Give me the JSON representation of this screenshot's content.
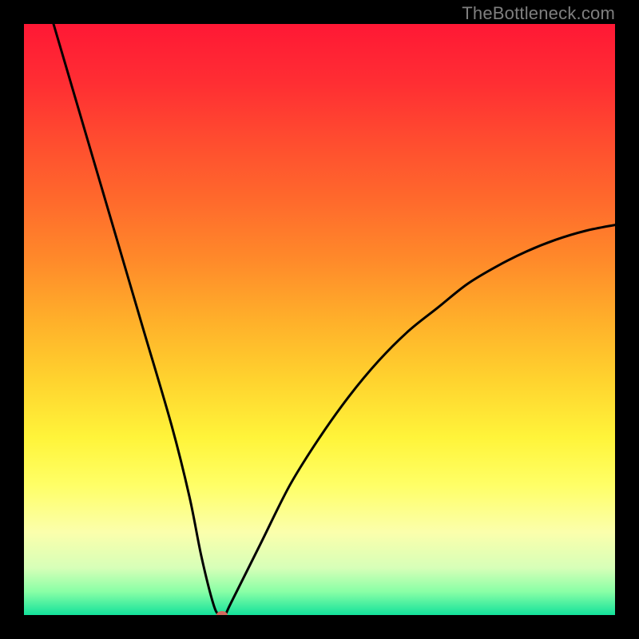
{
  "attribution": "TheBottleneck.com",
  "chart_data": {
    "type": "line",
    "title": "",
    "xlabel": "",
    "ylabel": "",
    "xlim": [
      0,
      100
    ],
    "ylim": [
      0,
      100
    ],
    "grid": false,
    "background_gradient_stops": [
      {
        "pos": 0.0,
        "color": "#ff1835"
      },
      {
        "pos": 0.1,
        "color": "#ff2e33"
      },
      {
        "pos": 0.2,
        "color": "#ff4d2f"
      },
      {
        "pos": 0.3,
        "color": "#ff6a2c"
      },
      {
        "pos": 0.4,
        "color": "#ff8a2a"
      },
      {
        "pos": 0.5,
        "color": "#ffaf2a"
      },
      {
        "pos": 0.6,
        "color": "#ffd22e"
      },
      {
        "pos": 0.7,
        "color": "#fff43a"
      },
      {
        "pos": 0.78,
        "color": "#ffff66"
      },
      {
        "pos": 0.86,
        "color": "#fbffac"
      },
      {
        "pos": 0.92,
        "color": "#d7ffb8"
      },
      {
        "pos": 0.96,
        "color": "#8affa6"
      },
      {
        "pos": 1.0,
        "color": "#13e29b"
      }
    ],
    "series": [
      {
        "name": "bottleneck-curve",
        "x": [
          5,
          10,
          15,
          20,
          25,
          28,
          30,
          32,
          33,
          34,
          35,
          40,
          45,
          50,
          55,
          60,
          65,
          70,
          75,
          80,
          85,
          90,
          95,
          100
        ],
        "y": [
          100,
          83,
          66,
          49,
          32,
          20,
          10,
          2,
          0,
          0,
          2,
          12,
          22,
          30,
          37,
          43,
          48,
          52,
          56,
          59,
          61.5,
          63.5,
          65,
          66
        ],
        "smoothing": true,
        "stroke": "#000000",
        "stroke_width": 3
      }
    ],
    "marker": {
      "x": 33.5,
      "y": 0,
      "rx": 7,
      "ry": 5,
      "fill": "#d2695e"
    }
  }
}
